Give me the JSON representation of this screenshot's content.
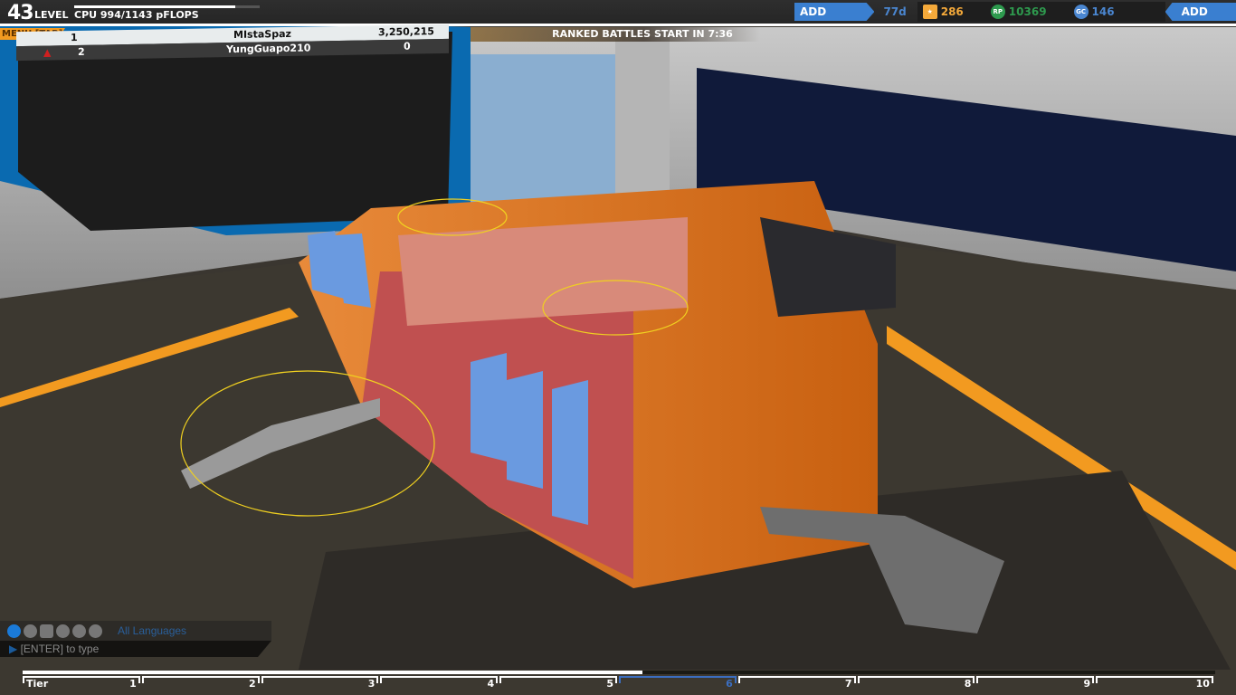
{
  "header": {
    "level": "43",
    "level_label": "LEVEL",
    "cpu": "CPU 994/1143 pFLOPS",
    "cpu_fraction": 0.87,
    "add_premium": "ADD PREMIUM",
    "premium_days": "77d",
    "rank_stars": "286",
    "rp": "10369",
    "gc": "146",
    "add_funds": "ADD FUNDS",
    "colors": {
      "accent": "#3a7fd0",
      "stars": "#f4a93a",
      "rp": "#2e9a4e",
      "gc": "#4a86d0"
    }
  },
  "banner": "RANKED BATTLES START IN 7:36",
  "menu": "MENU [TAB]",
  "scoreboard": [
    {
      "rank": "1",
      "name": "MIstaSpaz",
      "score": "3,250,215"
    },
    {
      "rank": "2",
      "name": "YungGuapo210",
      "score": "0"
    }
  ],
  "chat": {
    "icons": [
      "globe-icon",
      "person-icon",
      "party-icon",
      "team-1-icon",
      "team-2-icon",
      "team-3-icon"
    ],
    "channel": "All Languages",
    "placeholder": "[ENTER] to type"
  },
  "tiers": {
    "label": "Tier",
    "items": [
      "1",
      "2",
      "3",
      "4",
      "5",
      "6",
      "7",
      "8",
      "9",
      "10"
    ],
    "current": "6",
    "progress_percent": 52
  }
}
